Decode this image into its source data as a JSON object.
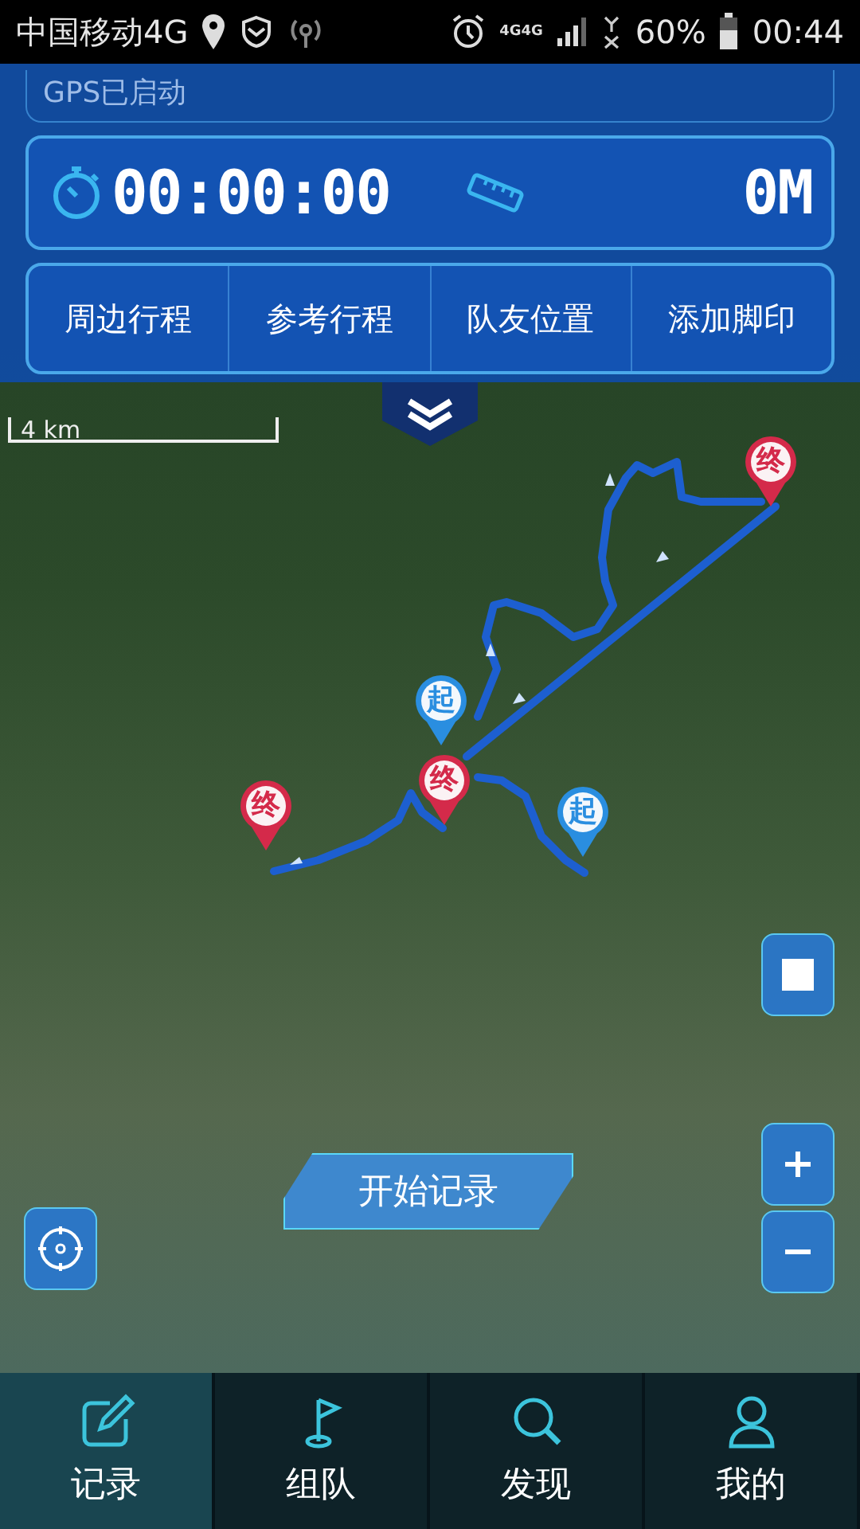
{
  "status_bar": {
    "carrier": "中国移动4G",
    "network": "4G4G",
    "battery": "60%",
    "time": "00:44"
  },
  "gps_status": "GPS已启动",
  "tracker": {
    "duration": "00:00:00",
    "distance": "0M"
  },
  "actions": [
    "周边行程",
    "参考行程",
    "队友位置",
    "添加脚印"
  ],
  "map": {
    "scale": "4 km",
    "markers": [
      {
        "kind": "end",
        "label": "终"
      },
      {
        "kind": "start",
        "label": "起"
      },
      {
        "kind": "end",
        "label": "终"
      },
      {
        "kind": "end",
        "label": "终"
      },
      {
        "kind": "start",
        "label": "起"
      }
    ],
    "start_button": "开始记录"
  },
  "tabs": [
    {
      "label": "记录",
      "selected": true
    },
    {
      "label": "组队",
      "selected": false
    },
    {
      "label": "发现",
      "selected": false
    },
    {
      "label": "我的",
      "selected": false
    }
  ]
}
